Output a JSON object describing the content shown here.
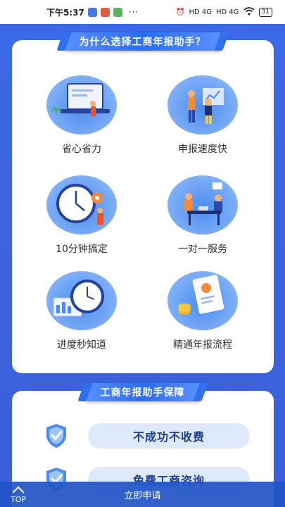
{
  "status_bar": {
    "time": "下午5:37",
    "dots": "···",
    "signal_1": "HD 4G",
    "signal_2": "HD 4G",
    "battery": "31"
  },
  "why_section": {
    "title": "为什么选择工商年报助手？",
    "features": [
      {
        "label": "省心省力",
        "icon": "laptop-person-illustration"
      },
      {
        "label": "申报速度快",
        "icon": "people-chart-illustration"
      },
      {
        "label": "10分钟搞定",
        "icon": "clock-gear-illustration"
      },
      {
        "label": "一对一服务",
        "icon": "meeting-table-illustration"
      },
      {
        "label": "进度秒知道",
        "icon": "progress-clock-illustration"
      },
      {
        "label": "精通年报流程",
        "icon": "report-coins-illustration"
      }
    ]
  },
  "guarantee_section": {
    "title": "工商年报助手保障",
    "items": [
      {
        "text": "不成功不收费",
        "icon": "check-shield-icon"
      },
      {
        "text": "免费工商咨询",
        "icon": "check-shield-icon"
      }
    ]
  },
  "bottom_bar": {
    "top_label": "TOP",
    "apply_label": "立即申请"
  },
  "colors": {
    "background": "#3b69e8",
    "banner": "#2b6cf6",
    "pill": "#dfe9fc",
    "pill_text": "#1f3f8f"
  }
}
